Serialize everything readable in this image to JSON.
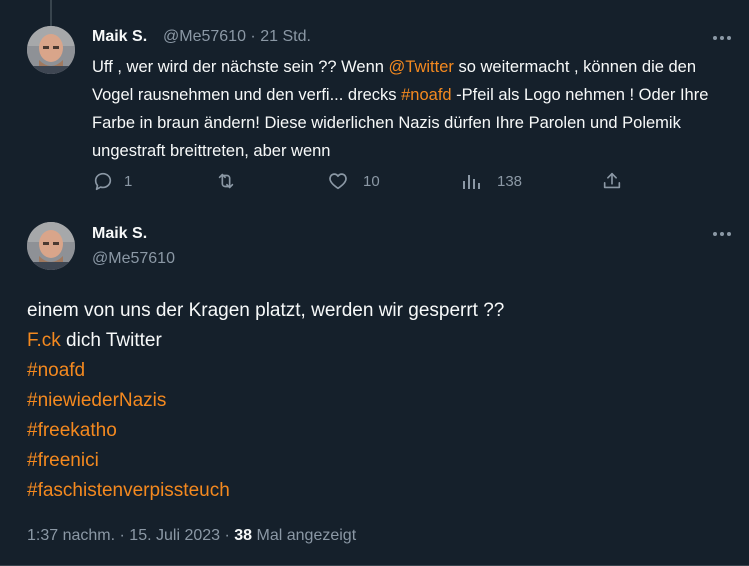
{
  "tweet1": {
    "author_name": "Maik S.",
    "handle": "@Me57610",
    "separator": "·",
    "time": "21 Std.",
    "text_segments": [
      {
        "text": "Uff , wer wird der nächste sein ?? Wenn ",
        "accent": false
      },
      {
        "text": "@Twitter",
        "accent": true
      },
      {
        "text": " so weitermacht , können die den Vogel rausnehmen und den verfi...  drecks ",
        "accent": false
      },
      {
        "text": "#noafd",
        "accent": true
      },
      {
        "text": " -Pfeil als Logo nehmen ! Oder Ihre Farbe in braun ändern! Diese widerlichen Nazis dürfen Ihre Parolen und Polemik ungestraft breittreten,  aber wenn",
        "accent": false
      }
    ],
    "actions": {
      "reply_count": "1",
      "retweet_count": "",
      "like_count": "10",
      "views_count": "138"
    }
  },
  "tweet2": {
    "author_name": "Maik S.",
    "handle": "@Me57610",
    "lines": [
      [
        {
          "text": "einem von uns der Kragen platzt, werden wir gesperrt ??",
          "accent": false
        }
      ],
      [
        {
          "text": "F.ck",
          "accent": true
        },
        {
          "text": " dich Twitter",
          "accent": false
        }
      ],
      [
        {
          "text": "#noafd",
          "accent": true
        }
      ],
      [
        {
          "text": "#niewiederNazis",
          "accent": true
        }
      ],
      [
        {
          "text": "#freekatho",
          "accent": true
        }
      ],
      [
        {
          "text": "#freenici",
          "accent": true
        }
      ],
      [
        {
          "text": "#faschistenverpissteuch",
          "accent": true
        }
      ]
    ],
    "meta": {
      "time": "1:37 nachm.",
      "dot": "·",
      "date": "15. Juli 2023",
      "views_number": "38",
      "views_label": "Mal angezeigt"
    }
  },
  "colors": {
    "background": "#15202b",
    "accent": "#f4891f",
    "text_primary": "#f7f9f9",
    "text_secondary": "#8b98a5"
  },
  "icons": [
    "more-icon",
    "reply-icon",
    "retweet-icon",
    "like-icon",
    "views-icon",
    "share-icon"
  ]
}
